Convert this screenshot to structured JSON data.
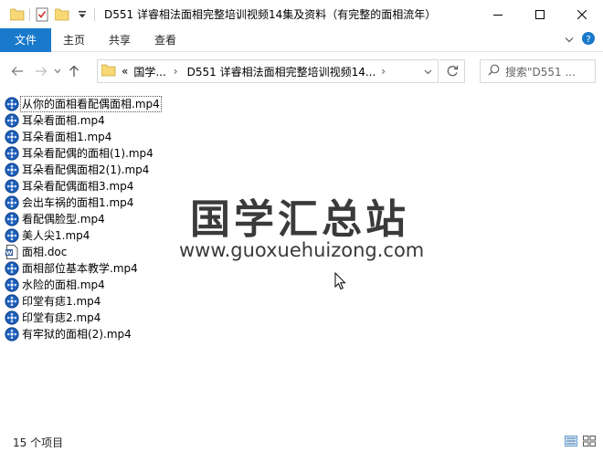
{
  "window": {
    "title": "D551 详睿相法面相完整培训视频14集及资料（有完整的面相流年）"
  },
  "ribbon": {
    "file": "文件",
    "tabs": [
      "主页",
      "共享",
      "查看"
    ]
  },
  "address": {
    "crumbs": [
      "«",
      "国学...",
      "›",
      "D551 详睿相法面相完整培训视频14...",
      "›"
    ]
  },
  "search": {
    "placeholder": "搜索\"D551 ..."
  },
  "files": [
    {
      "name": "从你的面相看配偶面相.mp4",
      "type": "video"
    },
    {
      "name": "耳朵看面相.mp4",
      "type": "video"
    },
    {
      "name": "耳朵看面相1.mp4",
      "type": "video"
    },
    {
      "name": "耳朵看配偶的面相(1).mp4",
      "type": "video"
    },
    {
      "name": "耳朵看配偶面相2(1).mp4",
      "type": "video"
    },
    {
      "name": "耳朵看配偶面相3.mp4",
      "type": "video"
    },
    {
      "name": "会出车祸的面相1.mp4",
      "type": "video"
    },
    {
      "name": "看配偶脸型.mp4",
      "type": "video"
    },
    {
      "name": "美人尖1.mp4",
      "type": "video"
    },
    {
      "name": "面相.doc",
      "type": "doc"
    },
    {
      "name": "面相部位基本教学.mp4",
      "type": "video"
    },
    {
      "name": "水险的面相.mp4",
      "type": "video"
    },
    {
      "name": "印堂有痣1.mp4",
      "type": "video"
    },
    {
      "name": "印堂有痣2.mp4",
      "type": "video"
    },
    {
      "name": "有牢狱的面相(2).mp4",
      "type": "video"
    }
  ],
  "watermark": {
    "title": "国学汇总站",
    "url": "www.guoxuehuizong.com"
  },
  "status": {
    "count": "15 个项目"
  },
  "colors": {
    "accent": "#1979ca",
    "folder": "#f8d775",
    "video_icon": "#1e5eb8"
  }
}
